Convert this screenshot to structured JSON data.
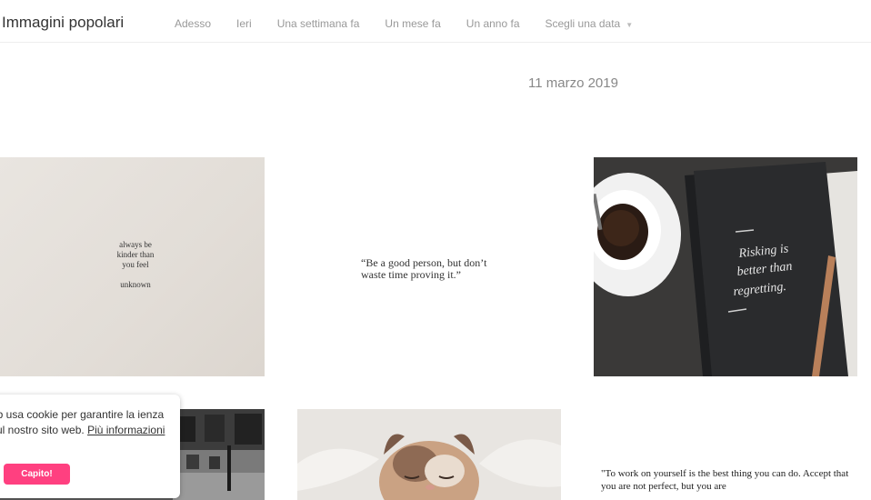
{
  "header": {
    "title": "Immagini popolari",
    "nav": [
      "Adesso",
      "Ieri",
      "Una settimana fa",
      "Un mese fa",
      "Un anno fa",
      "Scegli una data"
    ]
  },
  "date": "11 marzo 2019",
  "tiles": {
    "paper_lines": [
      "always be",
      "kinder than",
      "you feel"
    ],
    "paper_signature": "unknown",
    "quote1": "“Be a good person, but don’t waste time proving it.”",
    "notebook_lines": [
      "Risking is",
      "better than",
      "regretting."
    ],
    "quote2": "\"To work on yourself is the best thing you can do. Accept that you are not perfect, but you are"
  },
  "cookie": {
    "message": "eb usa cookie per garantire la ienza sul nostro sito web.",
    "link": "Più informazioni",
    "button": "Capito!"
  },
  "colors": {
    "accent": "#ff4080",
    "nav_text": "#999999"
  }
}
